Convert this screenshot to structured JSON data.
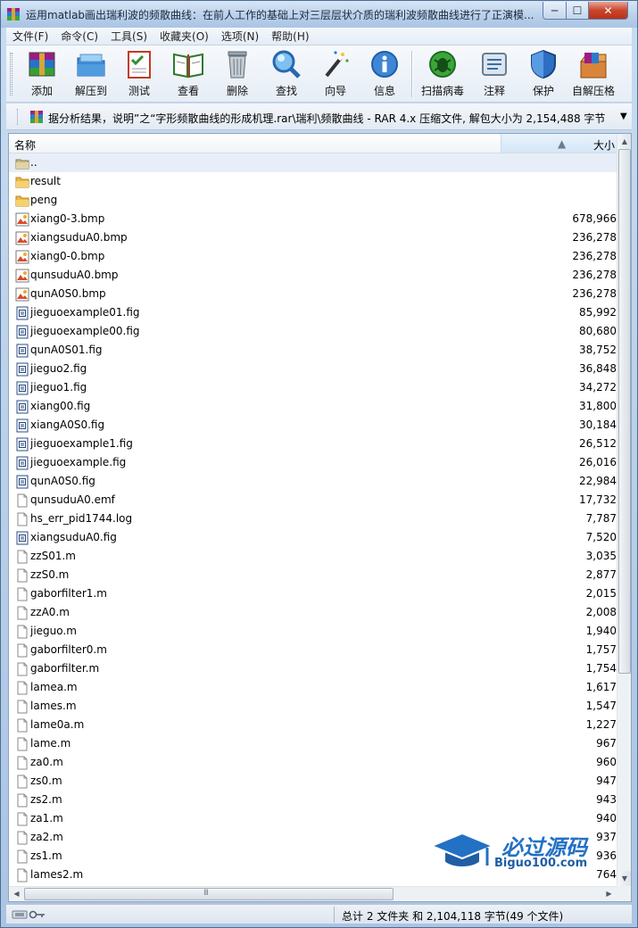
{
  "window": {
    "title": "运用matlab画出瑞利波的频散曲线：在前人工作的基础上对三层层状介质的瑞利波频散曲线进行了正演模...",
    "minimize": "─",
    "maximize": "☐",
    "close": "✕"
  },
  "menu": [
    "文件(F)",
    "命令(C)",
    "工具(S)",
    "收藏夹(O)",
    "选项(N)",
    "帮助(H)"
  ],
  "toolbar": [
    {
      "label": "添加",
      "icon": "add-archive-icon"
    },
    {
      "label": "解压到",
      "icon": "extract-to-icon"
    },
    {
      "label": "测试",
      "icon": "test-icon"
    },
    {
      "label": "查看",
      "icon": "view-icon"
    },
    {
      "label": "删除",
      "icon": "delete-icon"
    },
    {
      "label": "查找",
      "icon": "find-icon"
    },
    {
      "label": "向导",
      "icon": "wizard-icon"
    },
    {
      "label": "信息",
      "icon": "info-icon"
    },
    {
      "label": "扫描病毒",
      "icon": "virus-scan-icon"
    },
    {
      "label": "注释",
      "icon": "comment-icon"
    },
    {
      "label": "保护",
      "icon": "protect-icon"
    },
    {
      "label": "自解压格",
      "icon": "sfx-icon"
    }
  ],
  "address": {
    "path": "据分析结果，说明”之“字形频散曲线的形成机理.rar\\瑞利\\频散曲线 - RAR 4.x 压缩文件, 解包大小为 2,154,488 字节"
  },
  "columns": {
    "name": "名称",
    "size": "大小"
  },
  "files": [
    {
      "name": "..",
      "size": "",
      "type": "parent"
    },
    {
      "name": "result",
      "size": "",
      "type": "folder"
    },
    {
      "name": "peng",
      "size": "",
      "type": "folder"
    },
    {
      "name": "xiang0-3.bmp",
      "size": "678,966",
      "type": "bmp"
    },
    {
      "name": "xiangsuduA0.bmp",
      "size": "236,278",
      "type": "bmp"
    },
    {
      "name": "xiang0-0.bmp",
      "size": "236,278",
      "type": "bmp"
    },
    {
      "name": "qunsuduA0.bmp",
      "size": "236,278",
      "type": "bmp"
    },
    {
      "name": "qunA0S0.bmp",
      "size": "236,278",
      "type": "bmp"
    },
    {
      "name": "jieguoexample01.fig",
      "size": "85,992",
      "type": "fig"
    },
    {
      "name": "jieguoexample00.fig",
      "size": "80,680",
      "type": "fig"
    },
    {
      "name": "qunA0S01.fig",
      "size": "38,752",
      "type": "fig"
    },
    {
      "name": "jieguo2.fig",
      "size": "36,848",
      "type": "fig"
    },
    {
      "name": "jieguo1.fig",
      "size": "34,272",
      "type": "fig"
    },
    {
      "name": "xiang00.fig",
      "size": "31,800",
      "type": "fig"
    },
    {
      "name": "xiangA0S0.fig",
      "size": "30,184",
      "type": "fig"
    },
    {
      "name": "jieguoexample1.fig",
      "size": "26,512",
      "type": "fig"
    },
    {
      "name": "jieguoexample.fig",
      "size": "26,016",
      "type": "fig"
    },
    {
      "name": "qunA0S0.fig",
      "size": "22,984",
      "type": "fig"
    },
    {
      "name": "qunsuduA0.emf",
      "size": "17,732",
      "type": "file"
    },
    {
      "name": "hs_err_pid1744.log",
      "size": "7,787",
      "type": "file"
    },
    {
      "name": "xiangsuduA0.fig",
      "size": "7,520",
      "type": "fig"
    },
    {
      "name": "zzS01.m",
      "size": "3,035",
      "type": "file"
    },
    {
      "name": "zzS0.m",
      "size": "2,877",
      "type": "file"
    },
    {
      "name": "gaborfilter1.m",
      "size": "2,015",
      "type": "file"
    },
    {
      "name": "zzA0.m",
      "size": "2,008",
      "type": "file"
    },
    {
      "name": "jieguo.m",
      "size": "1,940",
      "type": "file"
    },
    {
      "name": "gaborfilter0.m",
      "size": "1,757",
      "type": "file"
    },
    {
      "name": "gaborfilter.m",
      "size": "1,754",
      "type": "file"
    },
    {
      "name": "lamea.m",
      "size": "1,617",
      "type": "file"
    },
    {
      "name": "lames.m",
      "size": "1,547",
      "type": "file"
    },
    {
      "name": "lame0a.m",
      "size": "1,227",
      "type": "file"
    },
    {
      "name": "lame.m",
      "size": "967",
      "type": "file"
    },
    {
      "name": "za0.m",
      "size": "960",
      "type": "file"
    },
    {
      "name": "zs0.m",
      "size": "947",
      "type": "file"
    },
    {
      "name": "zs2.m",
      "size": "943",
      "type": "file"
    },
    {
      "name": "za1.m",
      "size": "940",
      "type": "file"
    },
    {
      "name": "za2.m",
      "size": "937",
      "type": "file"
    },
    {
      "name": "zs1.m",
      "size": "936",
      "type": "file"
    },
    {
      "name": "lames2.m",
      "size": "764",
      "type": "file"
    }
  ],
  "status": {
    "summary": "总计 2 文件夹 和 2,104,118 字节(49 个文件)"
  },
  "watermark": {
    "main": "必过源码",
    "sub": "Biguo100.com"
  },
  "colors": {
    "selection": "#e8eef7",
    "watermark": "#2371c4"
  }
}
